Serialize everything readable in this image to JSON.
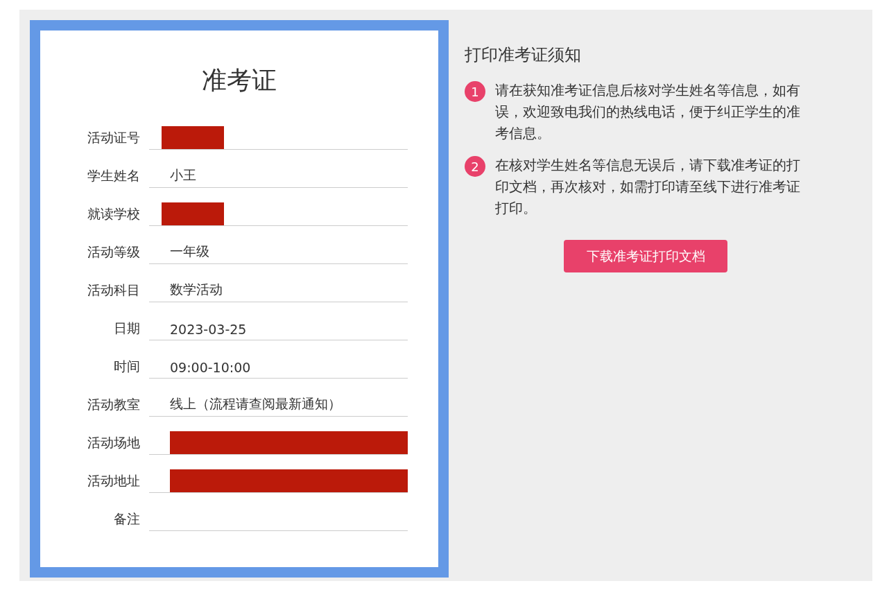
{
  "card": {
    "title": "准考证",
    "fields": [
      {
        "label": "活动证号",
        "kind": "redacted-short"
      },
      {
        "label": "学生姓名",
        "kind": "text",
        "value": "小王"
      },
      {
        "label": "就读学校",
        "kind": "redacted-short"
      },
      {
        "label": "活动等级",
        "kind": "text",
        "value": "一年级"
      },
      {
        "label": "活动科目",
        "kind": "text",
        "value": "数学活动"
      },
      {
        "label": "日期",
        "kind": "text",
        "value": "2023-03-25"
      },
      {
        "label": "时间",
        "kind": "text",
        "value": "09:00-10:00"
      },
      {
        "label": "活动教室",
        "kind": "text",
        "value": "线上（流程请查阅最新通知）"
      },
      {
        "label": "活动场地",
        "kind": "redacted-long"
      },
      {
        "label": "活动地址",
        "kind": "redacted-long"
      },
      {
        "label": "备注",
        "kind": "empty"
      }
    ]
  },
  "notice": {
    "title": "打印准考证须知",
    "items": [
      {
        "number": "1",
        "text": "请在获知准考证信息后核对学生姓名等信息，如有误，欢迎致电我们的热线电话，便于纠正学生的准考信息。"
      },
      {
        "number": "2",
        "text": "在核对学生姓名等信息无误后，请下载准考证的打印文档，再次核对，如需打印请至线下进行准考证打印。"
      }
    ],
    "button": "下载准考证打印文档"
  }
}
